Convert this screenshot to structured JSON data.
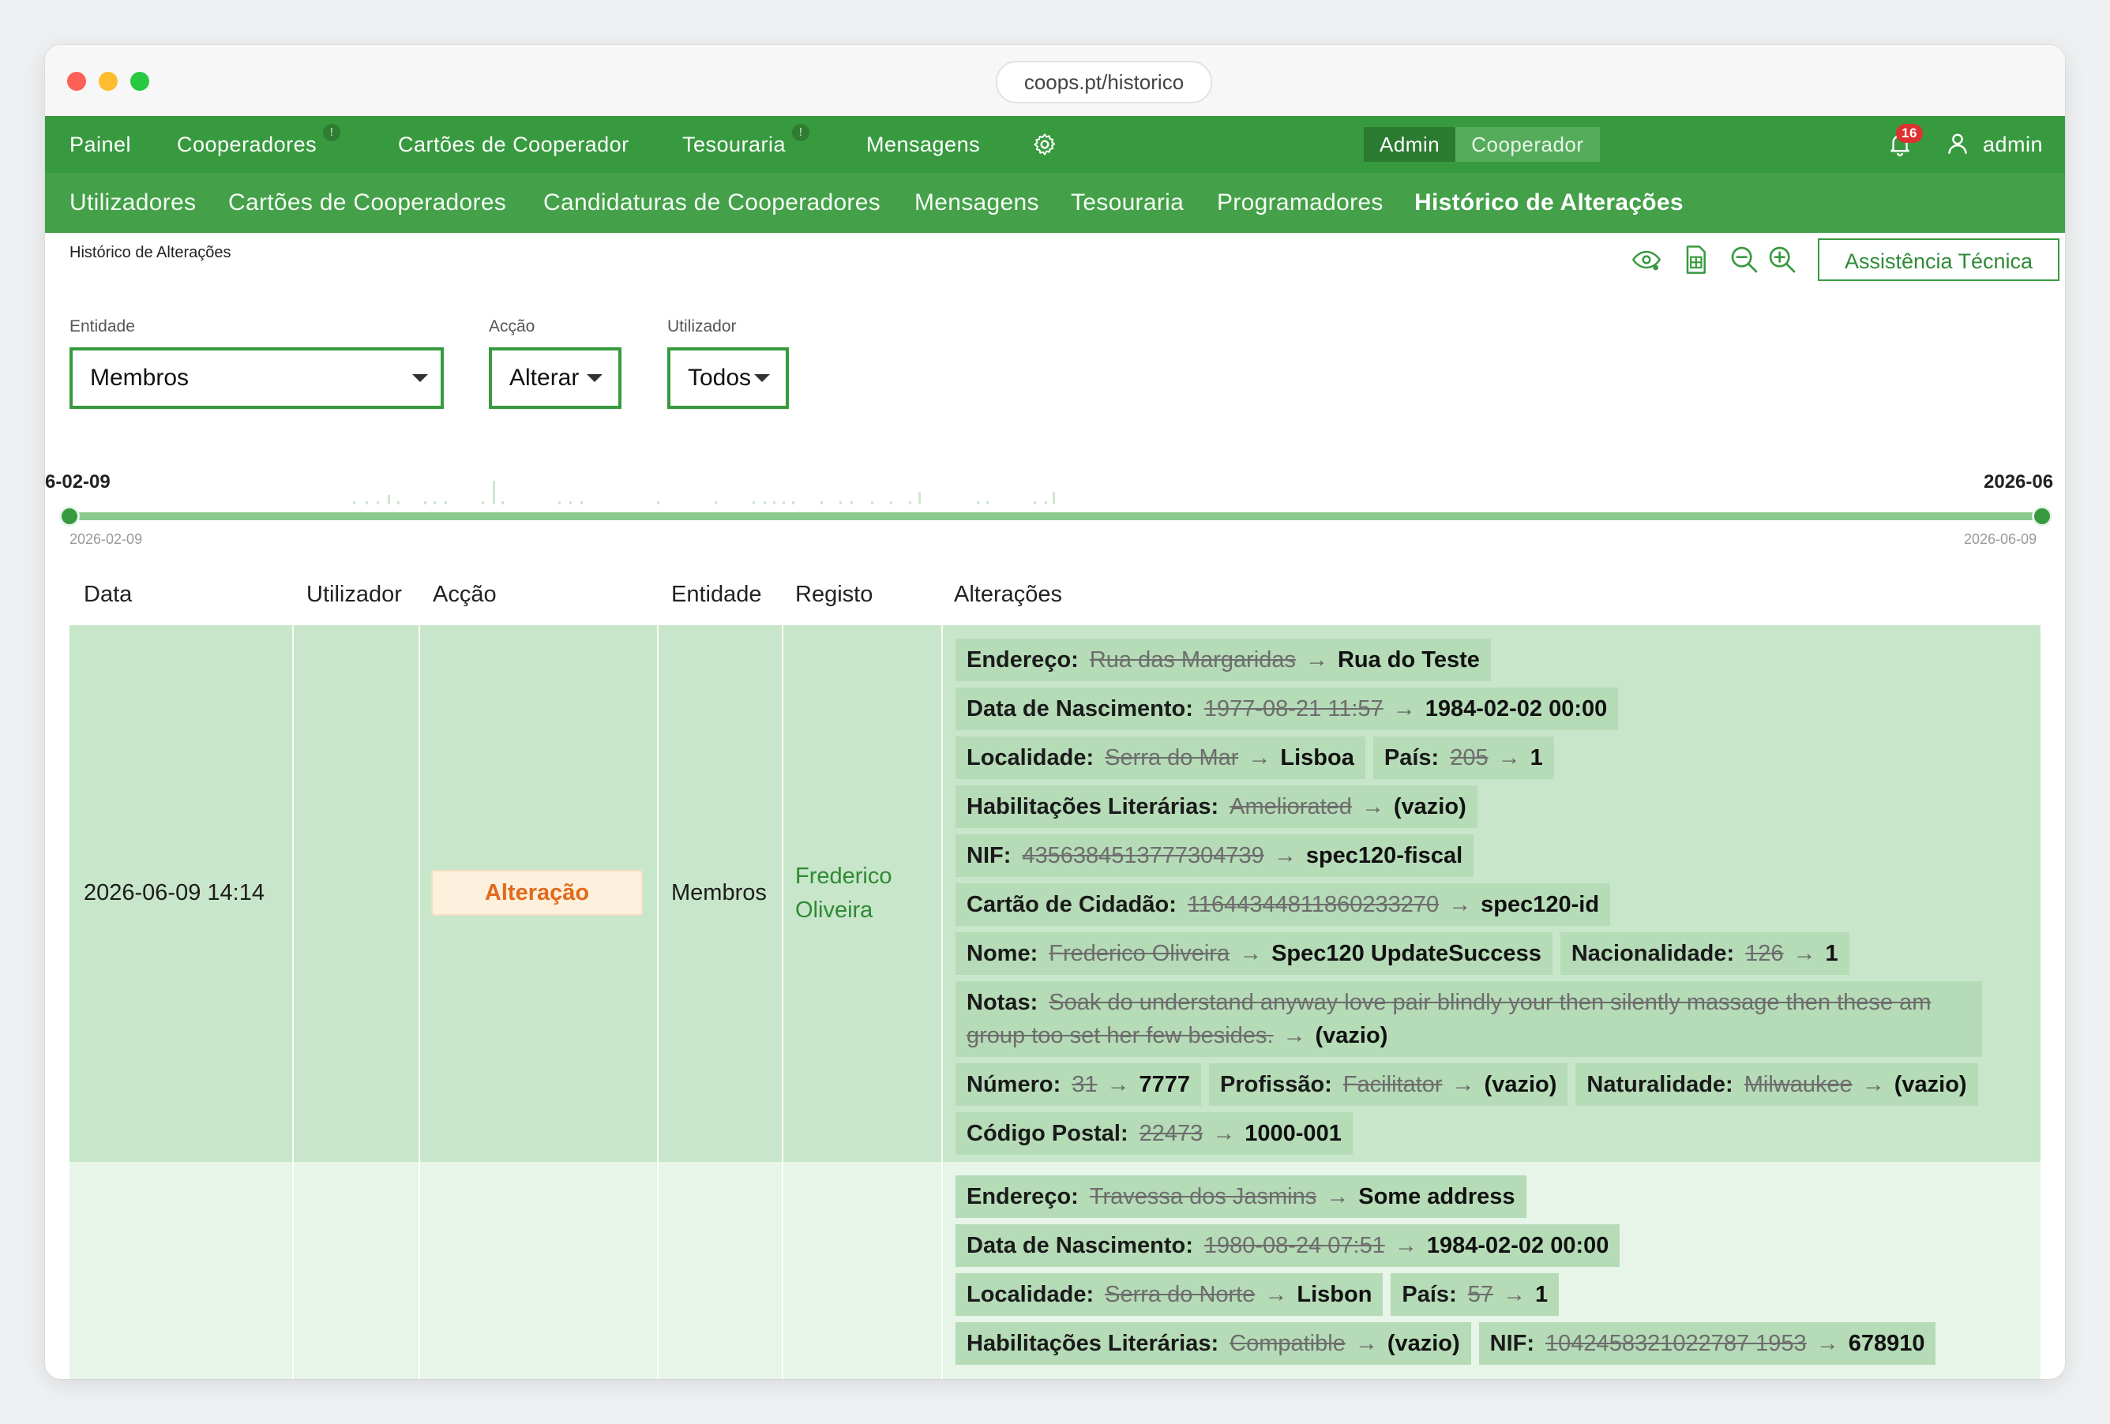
{
  "browser": {
    "url": "coops.pt/historico"
  },
  "topnav": {
    "items": [
      {
        "label": "Painel",
        "badge": ""
      },
      {
        "label": "Cooperadores",
        "badge": "!"
      },
      {
        "label": "Cartões de Cooperador",
        "badge": ""
      },
      {
        "label": "Tesouraria",
        "badge": "!"
      },
      {
        "label": "Mensagens",
        "badge": ""
      }
    ],
    "role_admin": "Admin",
    "role_cooperator": "Cooperador",
    "notifications_count": "16",
    "user": "admin"
  },
  "subnav": {
    "items": [
      "Utilizadores",
      "Cartões de Cooperadores",
      "Candidaturas de Cooperadores",
      "Mensagens",
      "Tesouraria",
      "Programadores",
      "Histórico de Alterações"
    ],
    "active": "Histórico de Alterações"
  },
  "breadcrumb": "Histórico de Alterações",
  "assist_button": "Assistência Técnica",
  "filters": {
    "entity": {
      "label": "Entidade",
      "value": "Membros"
    },
    "action": {
      "label": "Acção",
      "value": "Alterar"
    },
    "user": {
      "label": "Utilizador",
      "value": "Todos"
    }
  },
  "timeline": {
    "start_label": "6-02-09",
    "end_label": "2026-06",
    "start_date": "2026-02-09",
    "end_date": "2026-06-09"
  },
  "table": {
    "headers": [
      "Data",
      "Utilizador",
      "Acção",
      "Entidade",
      "Registo",
      "Alterações"
    ],
    "rows": [
      {
        "date": "2026-06-09 14:14",
        "user": "",
        "action": "Alteração",
        "entity": "Membros",
        "record": "Frederico Oliveira",
        "changes": [
          [
            {
              "field": "Endereço:",
              "old": "Rua das Margaridas",
              "new": "Rua do Teste"
            }
          ],
          [
            {
              "field": "Data de Nascimento:",
              "old": "1977-08-21 11:57",
              "new": "1984-02-02 00:00"
            }
          ],
          [
            {
              "field": "Localidade:",
              "old": "Serra do Mar",
              "new": "Lisboa"
            },
            {
              "field": "País:",
              "old": "205",
              "new": "1"
            }
          ],
          [
            {
              "field": "Habilitações Literárias:",
              "old": "Ameliorated",
              "new": "(vazio)"
            }
          ],
          [
            {
              "field": "NIF:",
              "old": "4356384513777304739",
              "new": "spec120-fiscal"
            }
          ],
          [
            {
              "field": "Cartão de Cidadão:",
              "old": "11644344811860233270",
              "new": "spec120-id"
            }
          ],
          [
            {
              "field": "Nome:",
              "old": "Frederico Oliveira",
              "new": "Spec120 UpdateSuccess"
            },
            {
              "field": "Nacionalidade:",
              "old": "126",
              "new": "1"
            }
          ],
          [
            {
              "field": "Notas:",
              "old": "Soak do understand anyway love pair blindly your then silently massage then these am group too set her few besides.",
              "new": "(vazio)",
              "wrap": true
            }
          ],
          [
            {
              "field": "Número:",
              "old": "31",
              "new": "7777"
            },
            {
              "field": "Profissão:",
              "old": "Facilitator",
              "new": "(vazio)"
            },
            {
              "field": "Naturalidade:",
              "old": "Milwaukee",
              "new": "(vazio)"
            }
          ],
          [
            {
              "field": "Código Postal:",
              "old": "22473",
              "new": "1000-001"
            }
          ]
        ]
      },
      {
        "date": "",
        "user": "",
        "action": "",
        "entity": "",
        "record": "",
        "changes": [
          [
            {
              "field": "Endereço:",
              "old": "Travessa dos Jasmins",
              "new": "Some address"
            }
          ],
          [
            {
              "field": "Data de Nascimento:",
              "old": "1980-08-24 07:51",
              "new": "1984-02-02 00:00"
            }
          ],
          [
            {
              "field": "Localidade:",
              "old": "Serra do Norte",
              "new": "Lisbon"
            },
            {
              "field": "País:",
              "old": "57",
              "new": "1"
            }
          ],
          [
            {
              "field": "Habilitações Literárias:",
              "old": "Compatible",
              "new": "(vazio)"
            },
            {
              "field": "NIF:",
              "old": "1042458321022787 1953",
              "new": "678910"
            }
          ]
        ]
      }
    ]
  }
}
